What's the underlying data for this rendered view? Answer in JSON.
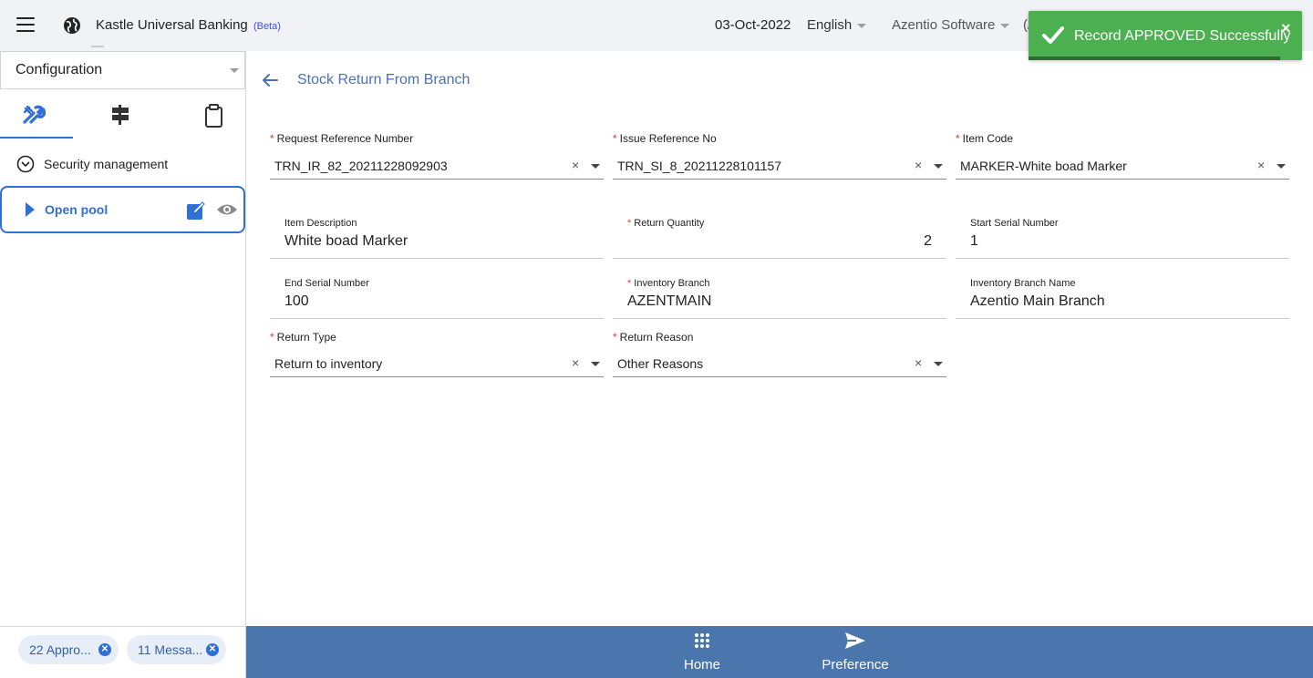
{
  "header": {
    "app_title": "Kastle Universal Banking",
    "beta": "(Beta)",
    "date": "03-Oct-2022",
    "language": "English",
    "organization": "Azentio Software",
    "truncated": "(/"
  },
  "toast": {
    "message": "Record APPROVED Successfully",
    "close": "×",
    "color": "#4caf50"
  },
  "sidebar": {
    "module_select": "Configuration",
    "tabs": [
      {
        "icon": "tools-icon",
        "active": true
      },
      {
        "icon": "signpost-icon",
        "active": false
      },
      {
        "icon": "clipboard-icon",
        "active": false
      }
    ],
    "group": "Security management",
    "active_item": "Open pool",
    "chips": [
      {
        "label": "22 Appro..."
      },
      {
        "label": "11 Messa..."
      }
    ]
  },
  "page": {
    "title": "Stock Return From Branch"
  },
  "form": {
    "request_ref": {
      "label": "Request Reference Number",
      "value": "TRN_IR_82_20211228092903"
    },
    "issue_ref": {
      "label": "Issue Reference No",
      "value": "TRN_SI_8_20211228101157"
    },
    "item_code": {
      "label": "Item Code",
      "value": "MARKER-White boad Marker"
    },
    "item_desc": {
      "label": "Item Description",
      "value": "White boad Marker"
    },
    "return_qty": {
      "label": "Return Quantity",
      "value": "2"
    },
    "start_serial": {
      "label": "Start Serial Number",
      "value": "1"
    },
    "end_serial": {
      "label": "End Serial Number",
      "value": "100"
    },
    "inv_branch": {
      "label": "Inventory Branch",
      "value": "AZENTMAIN"
    },
    "inv_branch_name": {
      "label": "Inventory Branch Name",
      "value": "Azentio Main Branch"
    },
    "return_type": {
      "label": "Return Type",
      "value": "Return to inventory"
    },
    "return_reason": {
      "label": "Return Reason",
      "value": "Other Reasons"
    },
    "required_mark": "*",
    "clear_glyph": "×"
  },
  "bottom_nav": {
    "home": "Home",
    "preference": "Preference"
  },
  "colors": {
    "accent": "#2f6fd6",
    "bottom_bar": "#4a76ad",
    "title": "#4a72b0"
  }
}
